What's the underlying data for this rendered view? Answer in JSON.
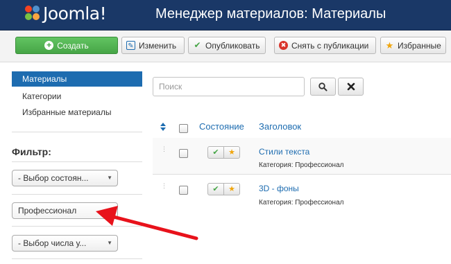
{
  "header": {
    "logo_text": "Joomla!",
    "title": "Менеджер материалов: Материалы",
    "background": "#1a3867"
  },
  "toolbar": {
    "create": "Создать",
    "edit": "Изменить",
    "publish": "Опубликовать",
    "unpublish": "Снять с публикации",
    "featured": "Избранные"
  },
  "sidebar": {
    "items": [
      {
        "label": "Материалы",
        "active": true
      },
      {
        "label": "Категории",
        "active": false
      },
      {
        "label": "Избранные материалы",
        "active": false
      }
    ],
    "filter_title": "Фильтр:",
    "state_select": "- Выбор состоян...",
    "category_value": "Профессионал",
    "level_select": "- Выбор числа у..."
  },
  "search": {
    "placeholder": "Поиск"
  },
  "table": {
    "headers": {
      "status": "Состояние",
      "title": "Заголовок"
    },
    "rows": [
      {
        "title": "Стили текста",
        "category": "Категория: Профессионал"
      },
      {
        "title": "3D - фоны",
        "category": "Категория: Профессионал"
      }
    ]
  },
  "colors": {
    "accent": "#1d6cb0",
    "create_button": "#46a546",
    "annotation_arrow": "#e8121b"
  }
}
